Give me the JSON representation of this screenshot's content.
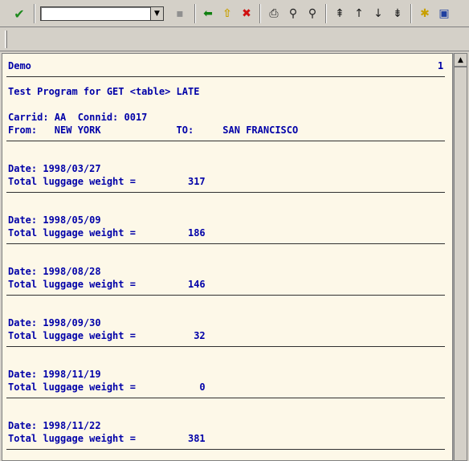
{
  "toolbar": {
    "enter_icon": "check-icon",
    "command_value": "",
    "icons": [
      "save-icon",
      "back-icon",
      "exit-icon",
      "cancel-icon",
      "print-icon",
      "find-icon",
      "find-next-icon",
      "first-page-icon",
      "prev-page-icon",
      "next-page-icon",
      "last-page-icon",
      "new-session-icon",
      "shortcut-icon"
    ]
  },
  "colors": {
    "text": "#0000a8",
    "list_bg": "#fdf8e8",
    "toolbar_bg": "#d4d0c8"
  },
  "list": {
    "header": {
      "title": "Demo",
      "page": "1"
    },
    "program_title": "Test Program for GET <table> LATE",
    "carrid_line": "Carrid: AA  Connid: 0017",
    "from_line": "From:   NEW YORK             TO:     SAN FRANCISCO",
    "entries": [
      {
        "date": "Date: 1998/03/27",
        "weight": "Total luggage weight =         317"
      },
      {
        "date": "Date: 1998/05/09",
        "weight": "Total luggage weight =         186"
      },
      {
        "date": "Date: 1998/08/28",
        "weight": "Total luggage weight =         146"
      },
      {
        "date": "Date: 1998/09/30",
        "weight": "Total luggage weight =          32"
      },
      {
        "date": "Date: 1998/11/19",
        "weight": "Total luggage weight =           0"
      },
      {
        "date": "Date: 1998/11/22",
        "weight": "Total luggage weight =         381"
      }
    ]
  }
}
